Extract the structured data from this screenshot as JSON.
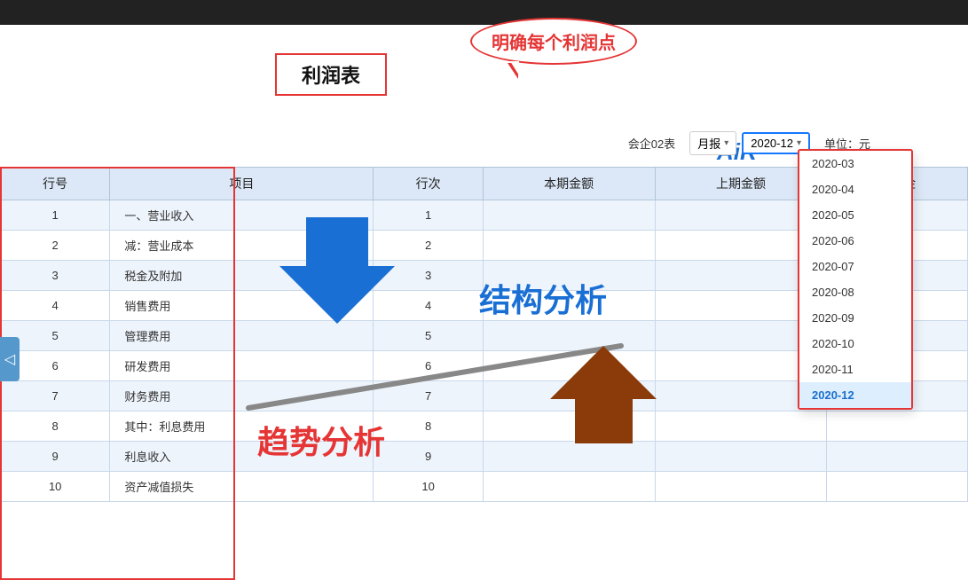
{
  "topBar": {},
  "title": "利润表",
  "speechBubble": "明确每个利润点",
  "controls": {
    "companyLabel": "会企02表",
    "periodType": "月报",
    "selectedPeriod": "2020-12",
    "unitLabel": "单位：元"
  },
  "dropdown": {
    "options": [
      "2020-03",
      "2020-04",
      "2020-05",
      "2020-06",
      "2020-07",
      "2020-08",
      "2020-09",
      "2020-10",
      "2020-11",
      "2020-12"
    ],
    "selected": "2020-12"
  },
  "table": {
    "headers": [
      "行号",
      "项目",
      "行次",
      "本期金额",
      "上期金额",
      "本年金"
    ],
    "rows": [
      {
        "rowNum": "1",
        "item": "一、营业收入",
        "seq": "1",
        "current": "",
        "prior": "",
        "annual": ""
      },
      {
        "rowNum": "2",
        "item": "减：营业成本",
        "seq": "2",
        "current": "",
        "prior": "",
        "annual": ""
      },
      {
        "rowNum": "3",
        "item": "税金及附加",
        "seq": "3",
        "current": "",
        "prior": "",
        "annual": ""
      },
      {
        "rowNum": "4",
        "item": "销售费用",
        "seq": "4",
        "current": "",
        "prior": "",
        "annual": ""
      },
      {
        "rowNum": "5",
        "item": "管理费用",
        "seq": "5",
        "current": "",
        "prior": "",
        "annual": ""
      },
      {
        "rowNum": "6",
        "item": "研发费用",
        "seq": "6",
        "current": "",
        "prior": "",
        "annual": ""
      },
      {
        "rowNum": "7",
        "item": "财务费用",
        "seq": "7",
        "current": "",
        "prior": "",
        "annual": ""
      },
      {
        "rowNum": "8",
        "item": "其中：利息费用",
        "seq": "8",
        "current": "",
        "prior": "",
        "annual": ""
      },
      {
        "rowNum": "9",
        "item": "利息收入",
        "seq": "9",
        "current": "",
        "prior": "",
        "annual": ""
      },
      {
        "rowNum": "10",
        "item": "资产减值损失",
        "seq": "10",
        "current": "",
        "prior": "",
        "annual": ""
      }
    ]
  },
  "overlayLabels": {
    "jiegou": "结构分析",
    "qushi": "趋势分析"
  },
  "airBrand": "AiR",
  "leftNavArrow": "◁"
}
